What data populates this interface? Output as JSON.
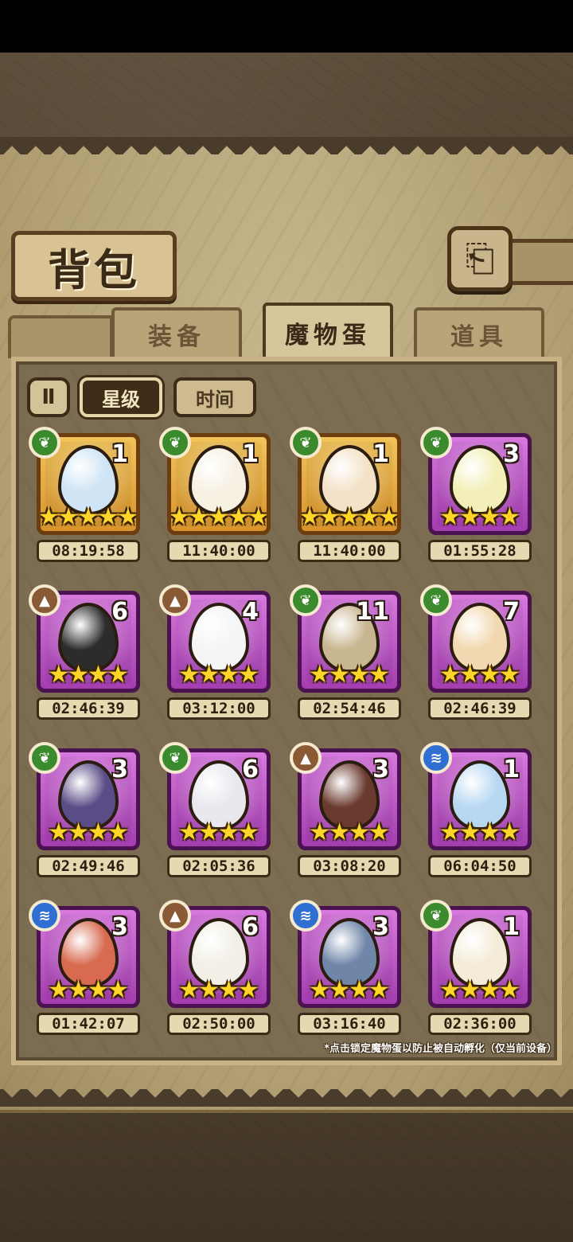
{
  "page": {
    "title": "背包",
    "back_icon": "back-arrow-icon",
    "footer_note": "*点击锁定魔物蛋以防止被自动孵化（仅当前设备）"
  },
  "tabs": [
    {
      "label": "装备",
      "active": false
    },
    {
      "label": "魔物蛋",
      "active": true
    },
    {
      "label": "道具",
      "active": false
    }
  ],
  "sort": {
    "toggle_icon": "pause-sort-icon",
    "toggle_glyph": "Ⅱ",
    "options": [
      {
        "label": "星级",
        "active": true
      },
      {
        "label": "时间",
        "active": false
      }
    ]
  },
  "colors": {
    "nature": "#3c8a2e",
    "earth": "#8a5a36",
    "water": "#2f6fd2",
    "gold_frame": "#f2c45a",
    "purple_frame": "#c65ed0",
    "star": "#ffd52a"
  },
  "eggs": [
    {
      "element": "nature",
      "element_glyph": "❦",
      "rarity": "gold",
      "stars": 5,
      "count": "1",
      "timer": "08:19:58",
      "egg_color": "#cfe4f5"
    },
    {
      "element": "nature",
      "element_glyph": "❦",
      "rarity": "gold",
      "stars": 5,
      "count": "1",
      "timer": "11:40:00",
      "egg_color": "#f7f1e4"
    },
    {
      "element": "nature",
      "element_glyph": "❦",
      "rarity": "gold",
      "stars": 5,
      "count": "1",
      "timer": "11:40:00",
      "egg_color": "#f3e2c8"
    },
    {
      "element": "nature",
      "element_glyph": "❦",
      "rarity": "purple",
      "stars": 4,
      "count": "3",
      "timer": "01:55:28",
      "egg_color": "#f2f0b8"
    },
    {
      "element": "earth",
      "element_glyph": "▲",
      "rarity": "purple",
      "stars": 4,
      "count": "6",
      "timer": "02:46:39",
      "egg_color": "#2c2c2c"
    },
    {
      "element": "earth",
      "element_glyph": "▲",
      "rarity": "purple",
      "stars": 4,
      "count": "4",
      "timer": "03:12:00",
      "egg_color": "#f5f5f5"
    },
    {
      "element": "nature",
      "element_glyph": "❦",
      "rarity": "purple",
      "stars": 4,
      "count": "11",
      "timer": "02:54:46",
      "egg_color": "#c8b690"
    },
    {
      "element": "nature",
      "element_glyph": "❦",
      "rarity": "purple",
      "stars": 4,
      "count": "7",
      "timer": "02:46:39",
      "egg_color": "#f2d8b0"
    },
    {
      "element": "nature",
      "element_glyph": "❦",
      "rarity": "purple",
      "stars": 4,
      "count": "3",
      "timer": "02:49:46",
      "egg_color": "#5a4c86"
    },
    {
      "element": "nature",
      "element_glyph": "❦",
      "rarity": "purple",
      "stars": 4,
      "count": "6",
      "timer": "02:05:36",
      "egg_color": "#e8e8ee"
    },
    {
      "element": "earth",
      "element_glyph": "▲",
      "rarity": "purple",
      "stars": 4,
      "count": "3",
      "timer": "03:08:20",
      "egg_color": "#6a3a2e"
    },
    {
      "element": "water",
      "element_glyph": "≋",
      "rarity": "purple",
      "stars": 4,
      "count": "1",
      "timer": "06:04:50",
      "egg_color": "#b8d8f2"
    },
    {
      "element": "water",
      "element_glyph": "≋",
      "rarity": "purple",
      "stars": 4,
      "count": "3",
      "timer": "01:42:07",
      "egg_color": "#d86a50"
    },
    {
      "element": "earth",
      "element_glyph": "▲",
      "rarity": "purple",
      "stars": 4,
      "count": "6",
      "timer": "02:50:00",
      "egg_color": "#f2efe6"
    },
    {
      "element": "water",
      "element_glyph": "≋",
      "rarity": "purple",
      "stars": 4,
      "count": "3",
      "timer": "03:16:40",
      "egg_color": "#6f86a8"
    },
    {
      "element": "nature",
      "element_glyph": "❦",
      "rarity": "purple",
      "stars": 4,
      "count": "1",
      "timer": "02:36:00",
      "egg_color": "#f4ecd8"
    }
  ]
}
